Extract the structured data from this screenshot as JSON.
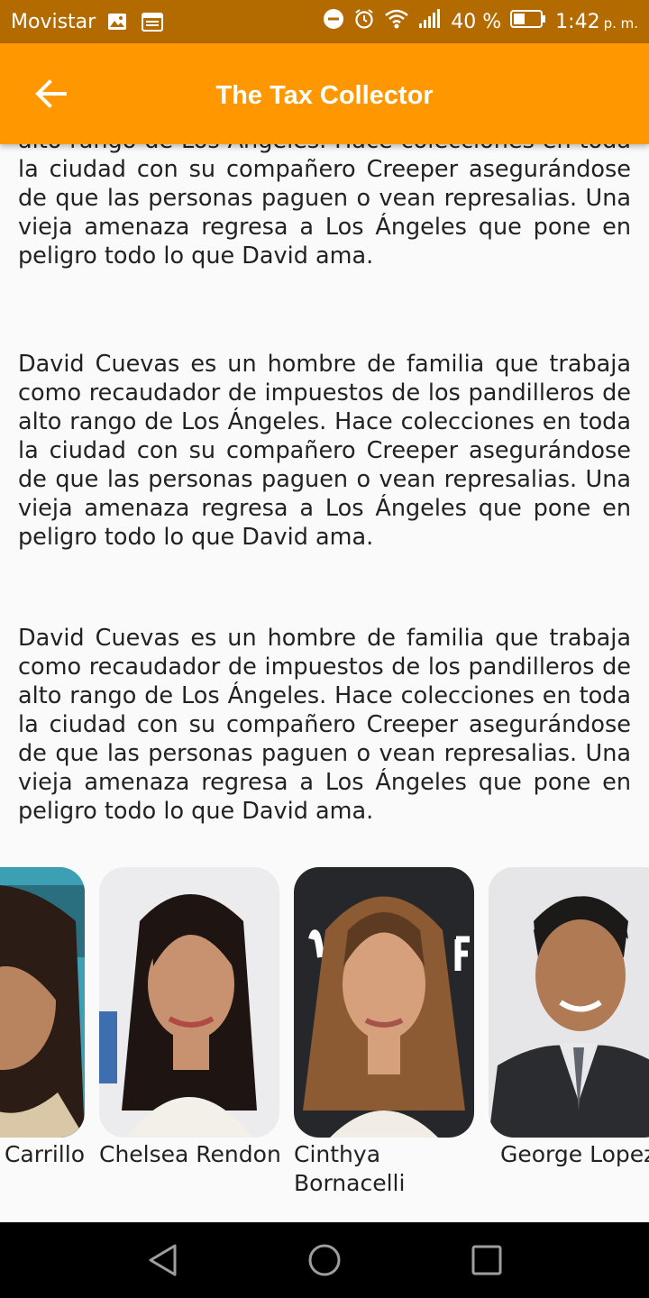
{
  "status_bar": {
    "carrier": "Movistar",
    "battery": "40 %",
    "time": "1:42",
    "ampm": "p. m."
  },
  "app_bar": {
    "title": "The Tax Collector"
  },
  "paragraphs": [
    "alto rango de Los Ángeles. Hace colecciones en toda la ciudad con su compañero Creeper asegurándose de que las personas paguen o vean represalias. Una vieja amenaza regresa a Los Ángeles que pone en peligro todo lo que David ama.",
    "David Cuevas es un hombre de familia que trabaja como recaudador de impuestos de los pandilleros de alto rango de Los Ángeles. Hace colecciones en toda la ciudad con su compañero Creeper asegurándose de que las personas paguen o vean represalias. Una vieja amenaza regresa a Los Ángeles que pone en peligro todo lo que David ama.",
    "David Cuevas es un hombre de familia que trabaja como recaudador de impuestos de los pandilleros de alto rango de Los Ángeles. Hace colecciones en toda la ciudad con su compañero Creeper asegurándose de que las personas paguen o vean represalias. Una vieja amenaza regresa a Los Ángeles que pone en peligro todo lo que David ama."
  ],
  "cast": [
    {
      "name": "Carrillo",
      "photo_icon": "woman-portrait"
    },
    {
      "name": "Chelsea Rendon",
      "photo_icon": "woman-portrait"
    },
    {
      "name": "Cinthya Bornacelli",
      "photo_icon": "woman-portrait"
    },
    {
      "name": "George Lopez",
      "photo_icon": "man-portrait"
    }
  ],
  "icons": {
    "back": "arrow-left-icon",
    "nav_back": "triangle-back-icon",
    "nav_home": "circle-home-icon",
    "nav_recents": "square-recents-icon"
  },
  "colors": {
    "status_bar": "#b36b00",
    "app_bar": "#ff9800",
    "background": "#fafafa",
    "nav_bar": "#000000"
  }
}
